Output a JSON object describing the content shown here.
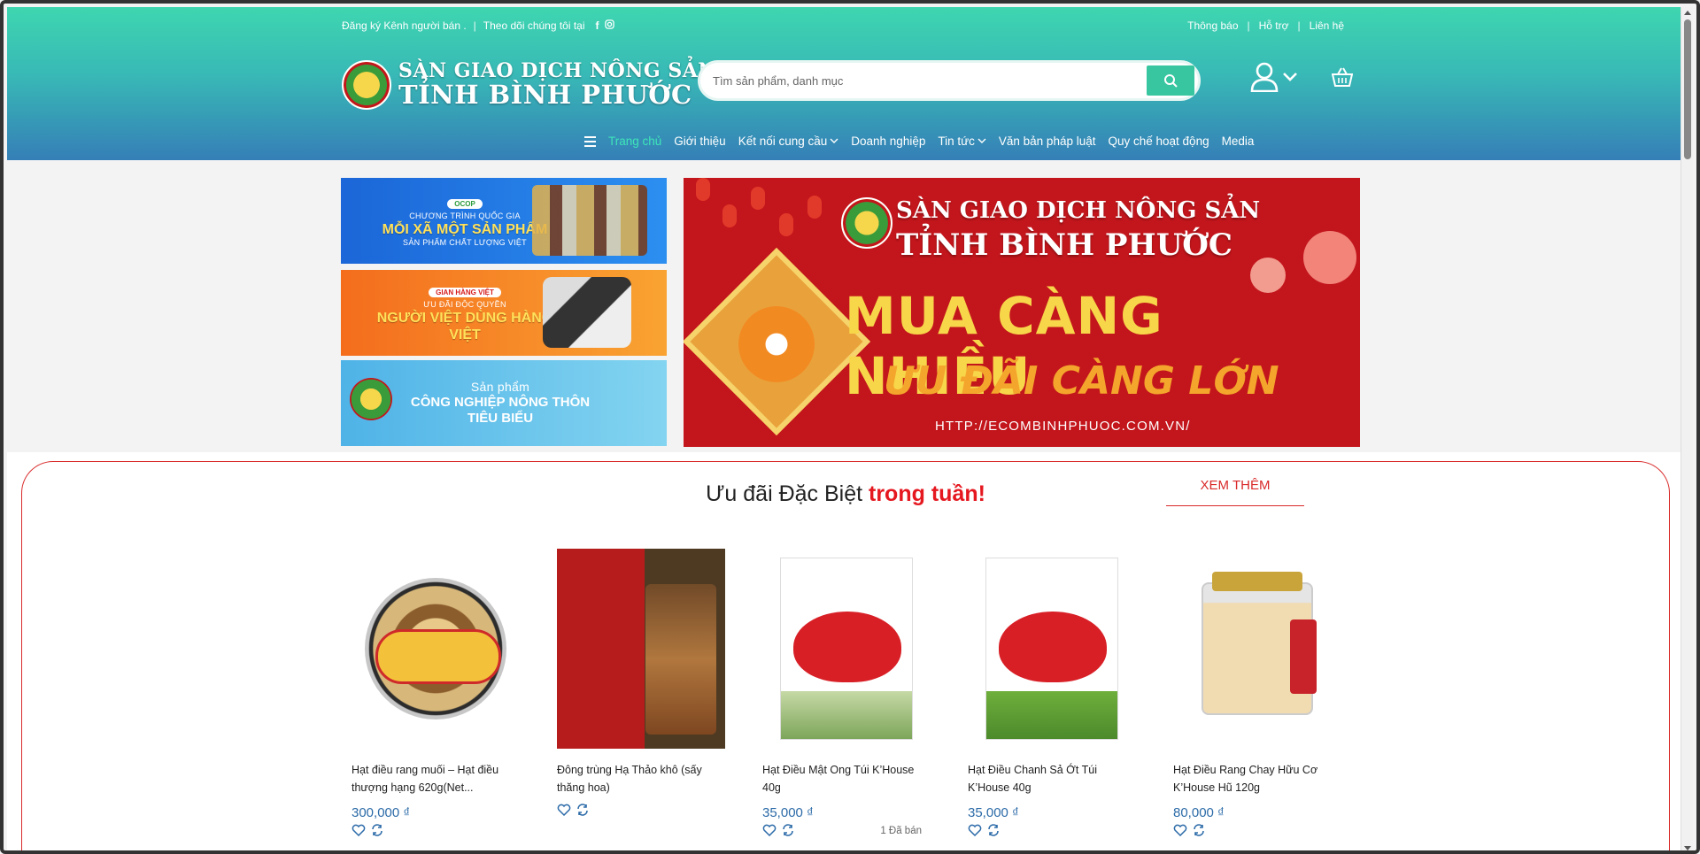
{
  "topbar": {
    "register_seller": "Đăng ký Kênh người bán .",
    "follow_us": "Theo dõi chúng tôi tại",
    "notifications": "Thông báo",
    "support": "Hỗ trợ",
    "contact": "Liên hệ"
  },
  "logo": {
    "line1": "SÀN GIAO DỊCH NÔNG SẢN",
    "line2": "TỈNH BÌNH PHƯỚC"
  },
  "search": {
    "placeholder": "Tìm sản phẩm, danh mục"
  },
  "nav": {
    "items": [
      {
        "label": "Trang chủ",
        "active": true
      },
      {
        "label": "Giới thiệu"
      },
      {
        "label": "Kết nối cung cầu",
        "dropdown": true
      },
      {
        "label": "Doanh nghiệp"
      },
      {
        "label": "Tin tức",
        "dropdown": true
      },
      {
        "label": "Văn bản pháp luật"
      },
      {
        "label": "Quy chế hoạt động"
      },
      {
        "label": "Media"
      }
    ]
  },
  "banners": {
    "side1": {
      "badge": "OCOP",
      "small": "CHƯƠNG TRÌNH QUỐC GIA",
      "big": "MỖI XÃ MỘT SẢN PHẨM",
      "small2": "SẢN PHẨM CHẤT LƯỢNG VIỆT"
    },
    "side2": {
      "badge": "GIAN HÀNG VIỆT",
      "small": "ƯU ĐÃI ĐỘC QUYỀN",
      "big": "NGƯỜI VIỆT DÙNG HÀNG VIỆT"
    },
    "side3": {
      "small": "Sản phẩm",
      "big": "CÔNG NGHIỆP NÔNG THÔN TIÊU BIỂU"
    },
    "main": {
      "title1": "SÀN GIAO DỊCH NÔNG SẢN",
      "title2": "TỈNH BÌNH PHƯỚC",
      "slogan1": "MUA CÀNG NHIỀU",
      "slogan2": "ƯU ĐÃI CÀNG LỚN",
      "url": "HTTP://ECOMBINHPHUOC.COM.VN/"
    }
  },
  "specials": {
    "title_prefix": "Ưu đãi Đặc Biệt ",
    "title_highlight": "trong tuần!",
    "see_more": "XEM THÊM",
    "products": [
      {
        "name": "Hạt điều rang muối – Hạt điều thượng hạng 620g(Net...",
        "price": "300,000 ₫",
        "sold": ""
      },
      {
        "name": "Đông trùng Hạ Thảo khô (sấy thăng hoa)",
        "price": "",
        "sold": ""
      },
      {
        "name": "Hạt Điều Mật Ong Túi K’House 40g",
        "price": "35,000 ₫",
        "sold": "1 Đã bán"
      },
      {
        "name": "Hạt Điều Chanh Sả Ớt Túi K’House 40g",
        "price": "35,000 ₫",
        "sold": ""
      },
      {
        "name": "Hạt Điều Rang Chay Hữu Cơ K’House Hũ 120g",
        "price": "80,000 ₫",
        "sold": ""
      }
    ]
  },
  "colors": {
    "header_top": "#3ed6b0",
    "header_bottom": "#357fb7",
    "accent_red": "#e5171f",
    "price_blue": "#2c6ba8"
  }
}
